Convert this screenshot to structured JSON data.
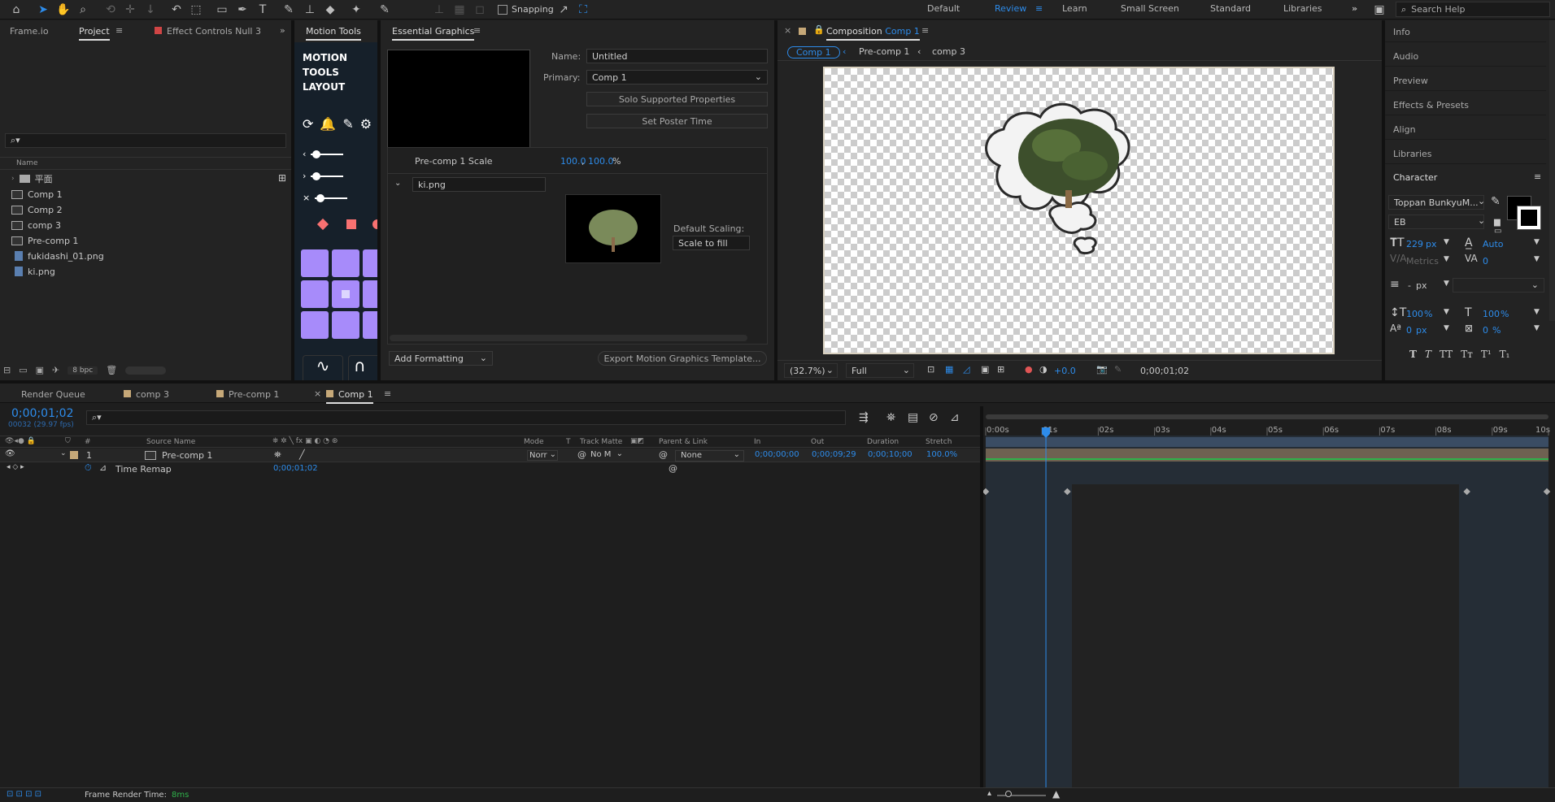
{
  "toolbar": {
    "snapping_label": "Snapping",
    "workspaces": [
      "Default",
      "Review",
      "Learn",
      "Small Screen",
      "Standard",
      "Libraries"
    ],
    "active_workspace": "Review",
    "search_placeholder": "Search Help"
  },
  "left_panel": {
    "tabs": [
      "Frame.io",
      "Project",
      "Effect Controls",
      "Null 3"
    ],
    "search_placeholder": "",
    "column_name": "Name",
    "items": [
      {
        "name": "平面",
        "type": "folder"
      },
      {
        "name": "Comp 1",
        "type": "comp"
      },
      {
        "name": "Comp 2",
        "type": "comp"
      },
      {
        "name": "comp 3",
        "type": "comp"
      },
      {
        "name": "Pre-comp 1",
        "type": "comp"
      },
      {
        "name": "fukidashi_01.png",
        "type": "file"
      },
      {
        "name": "ki.png",
        "type": "file"
      }
    ],
    "bpc": "8 bpc"
  },
  "motion_tools": {
    "tab": "Motion Tools",
    "logo_lines": [
      "MOTION",
      "TOOLS",
      "LAYOUT"
    ]
  },
  "essential_graphics": {
    "tab": "Essential Graphics",
    "name_label": "Name:",
    "name_value": "Untitled",
    "primary_label": "Primary:",
    "primary_value": "Comp 1",
    "solo_button": "Solo Supported Properties",
    "poster_button": "Set Poster Time",
    "scale_label": "Pre-comp 1 Scale",
    "scale_x": "100.0",
    "scale_sep": ",",
    "scale_y": "100.0",
    "scale_unit": "%",
    "media_name": "ki.png",
    "default_scaling_label": "Default Scaling:",
    "default_scaling_value": "Scale to fill",
    "add_formatting": "Add Formatting",
    "export_button": "Export Motion Graphics Template..."
  },
  "composition": {
    "tab_prefix": "Composition",
    "tab_name": "Comp 1",
    "breadcrumbs": [
      "Comp 1",
      "Pre-comp 1",
      "comp 3"
    ],
    "zoom": "(32.7%)",
    "resolution": "Full",
    "exposure": "+0.0",
    "timecode": "0;00;01;02"
  },
  "right_panel": {
    "items": [
      "Info",
      "Audio",
      "Preview",
      "Effects & Presets",
      "Align",
      "Libraries"
    ],
    "character_title": "Character",
    "font_family": "Toppan BunkyuM...",
    "font_style": "EB",
    "font_size": "229",
    "font_size_unit": "px",
    "leading": "Auto",
    "kerning": "Metrics",
    "tracking": "0",
    "stroke_width": "-",
    "stroke_unit": "px",
    "vscale": "100",
    "vscale_unit": "%",
    "hscale": "100",
    "hscale_unit": "%",
    "baseline": "0",
    "baseline_unit": "px",
    "tsume": "0",
    "tsume_unit": "%",
    "styles": [
      "T",
      "T",
      "TT",
      "Tт",
      "T¹",
      "T₁"
    ]
  },
  "timeline": {
    "tabs": [
      "Render Queue",
      "comp 3",
      "Pre-comp 1",
      "Comp 1"
    ],
    "active_tab": "Comp 1",
    "timecode": "0;00;01;02",
    "frame_info": "00032 (29.97 fps)",
    "columns": [
      "#",
      "Source Name",
      "Mode",
      "T",
      "Track Matte",
      "Parent & Link",
      "In",
      "Out",
      "Duration",
      "Stretch"
    ],
    "layer": {
      "number": "1",
      "name": "Pre-comp 1",
      "mode": "Norr",
      "matte": "No M",
      "parent": "None",
      "in": "0;00;00;00",
      "out": "0;00;09;29",
      "duration": "0;00;10;00",
      "stretch": "100.0%"
    },
    "property": {
      "name": "Time Remap",
      "value": "0;00;01;02"
    },
    "ruler": [
      "0:00s",
      "01s",
      "02s",
      "03s",
      "04s",
      "05s",
      "06s",
      "07s",
      "08s",
      "09s",
      "10s"
    ],
    "playhead_seconds": 1.07,
    "render_time_label": "Frame Render Time:",
    "render_time_value": "8ms"
  }
}
